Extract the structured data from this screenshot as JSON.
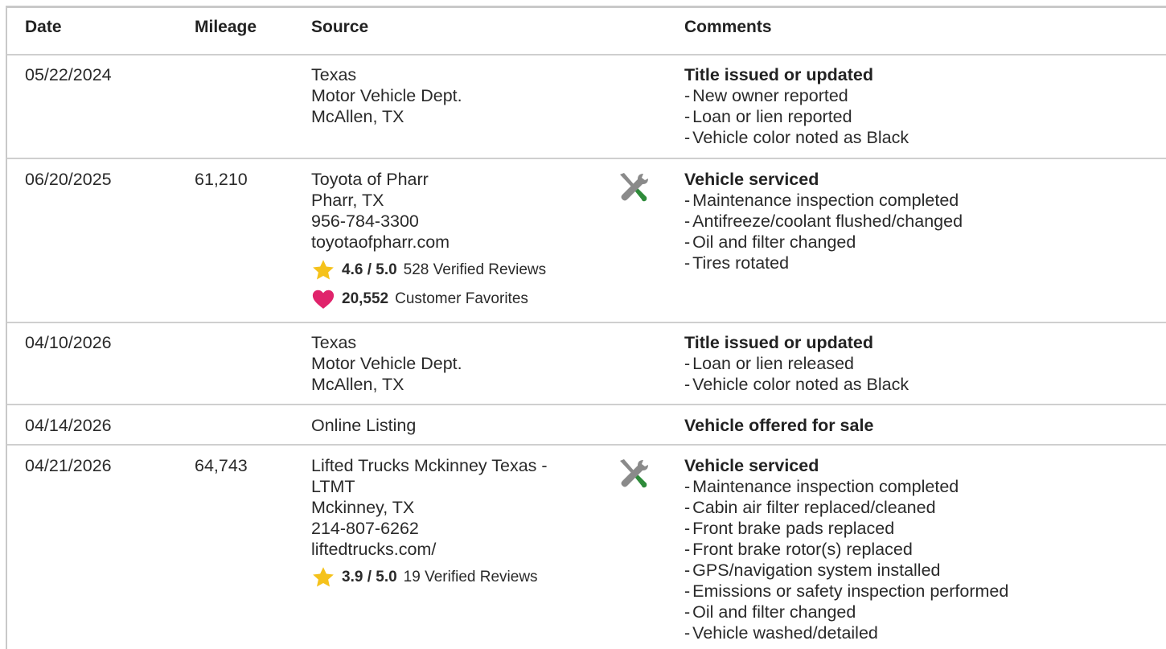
{
  "header": {
    "date": "Date",
    "mileage": "Mileage",
    "source": "Source",
    "comments": "Comments"
  },
  "records": [
    {
      "date": "05/22/2024",
      "mileage": "",
      "source": [
        "Texas",
        "Motor Vehicle Dept.",
        "McAllen, TX"
      ],
      "service_icon": false,
      "comment_title": "Title issued or updated",
      "comments": [
        "New owner reported",
        "Loan or lien reported",
        "Vehicle color noted as Black"
      ]
    },
    {
      "date": "06/20/2025",
      "mileage": "61,210",
      "source": [
        "Toyota of Pharr",
        "Pharr, TX",
        "956-784-3300",
        "toyotaofpharr.com"
      ],
      "rating": {
        "icon": "star-icon",
        "score": "4.6 / 5.0",
        "reviews": "528 Verified Reviews"
      },
      "favorites": {
        "icon": "heart-icon",
        "count": "20,552",
        "label": "Customer Favorites"
      },
      "service_icon": true,
      "comment_title": "Vehicle serviced",
      "comments": [
        "Maintenance inspection completed",
        "Antifreeze/coolant flushed/changed",
        "Oil and filter changed",
        "Tires rotated"
      ]
    },
    {
      "date": "04/10/2026",
      "mileage": "",
      "source": [
        "Texas",
        "Motor Vehicle Dept.",
        "McAllen, TX"
      ],
      "service_icon": false,
      "comment_title": "Title issued or updated",
      "comments": [
        "Loan or lien released",
        "Vehicle color noted as Black"
      ]
    },
    {
      "date": "04/14/2026",
      "mileage": "",
      "source": [
        "Online Listing"
      ],
      "service_icon": false,
      "comment_title": "Vehicle offered for sale",
      "comments": []
    },
    {
      "date": "04/21/2026",
      "mileage": "64,743",
      "source": [
        "Lifted Trucks Mckinney Texas -",
        "LTMT",
        "Mckinney, TX",
        "214-807-6262",
        "liftedtrucks.com/"
      ],
      "rating": {
        "icon": "star-icon",
        "score": "3.9 / 5.0",
        "reviews": "19 Verified Reviews"
      },
      "service_icon": true,
      "comment_title": "Vehicle serviced",
      "comments": [
        "Maintenance inspection completed",
        "Cabin air filter replaced/cleaned",
        "Front brake pads replaced",
        "Front brake rotor(s) replaced",
        "GPS/navigation system installed",
        "Emissions or safety inspection performed",
        "Oil and filter changed",
        "Vehicle washed/detailed"
      ]
    }
  ],
  "colors": {
    "star": "#f5c21b",
    "heart": "#e0236b",
    "wrench": "#8a8a8a",
    "screwdriver_handle": "#2e8b3a",
    "divider": "#cfcfcf"
  }
}
